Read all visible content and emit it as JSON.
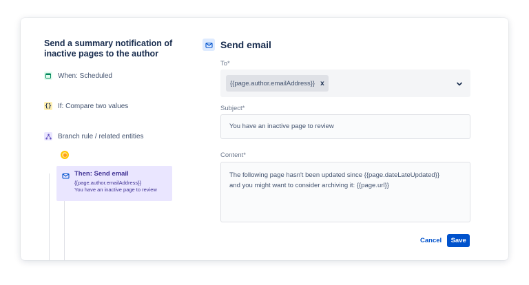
{
  "rule": {
    "title": "Send a summary notification of inactive pages to the author"
  },
  "steps": {
    "when": {
      "label": "When: Scheduled",
      "icon": "calendar-icon"
    },
    "if": {
      "label": "If: Compare two values",
      "icon": "braces-icon",
      "icon_glyph": "{}"
    },
    "branch": {
      "label": "Branch rule / related entities",
      "icon": "branch-icon"
    },
    "then": {
      "title": "Then: Send email",
      "line1": "{{page.author.emailAddress}}",
      "line2": "You have an inactive page to review",
      "icon": "mail-icon"
    }
  },
  "form": {
    "title": "Send email",
    "to_label": "To*",
    "to_chip": "{{page.author.emailAddress}}",
    "to_chip_remove": "x",
    "subject_label": "Subject*",
    "subject_value": "You have an inactive page to review",
    "content_label": "Content*",
    "content_line1": "The following page hasn't been updated since {{page.dateLateUpdated}}",
    "content_line2": "and you might want to consider archiving it: {{page.url}}",
    "cancel_label": "Cancel",
    "save_label": "Save"
  },
  "colors": {
    "accent": "#0052CC",
    "then_box": "#EAE6FF",
    "node_dot": "#FFC400"
  }
}
